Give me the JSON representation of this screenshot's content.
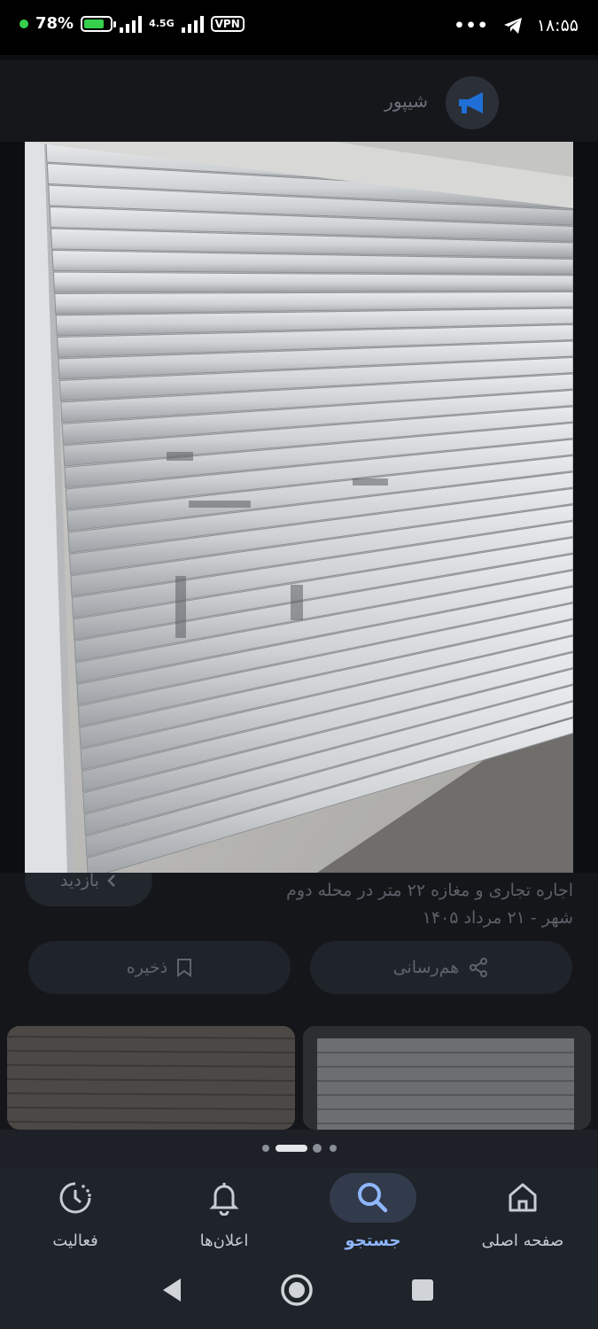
{
  "status_bar": {
    "battery": "78%",
    "battery_level": 0.78,
    "network": "4.5G",
    "vpn": "VPN",
    "time": "۱۸:۵۵",
    "more": "•••"
  },
  "header": {
    "app_name": "شیپور"
  },
  "listing": {
    "visit_button": "بازدید",
    "description_line1": "اجاره تجاری و مغازه ۲۲ متر در محله دوم",
    "description_line2": "شهر - ۲۱ مرداد ۱۴۰۵",
    "save_label": "ذخیره",
    "share_label": "هم‌رسانی"
  },
  "pager": {
    "count": 4,
    "active": 1
  },
  "bottom_nav": {
    "items": [
      {
        "label": "صفحه اصلی",
        "icon": "home-icon"
      },
      {
        "label": "جستجو",
        "icon": "search-icon"
      },
      {
        "label": "اعلان‌ها",
        "icon": "bell-icon"
      },
      {
        "label": "فعالیت",
        "icon": "activity-icon"
      }
    ]
  },
  "colors": {
    "accent": "#8fb6ff",
    "active_pill": "#323b4b",
    "nav_bg": "#1f232a",
    "battery_green": "#36d04c"
  }
}
